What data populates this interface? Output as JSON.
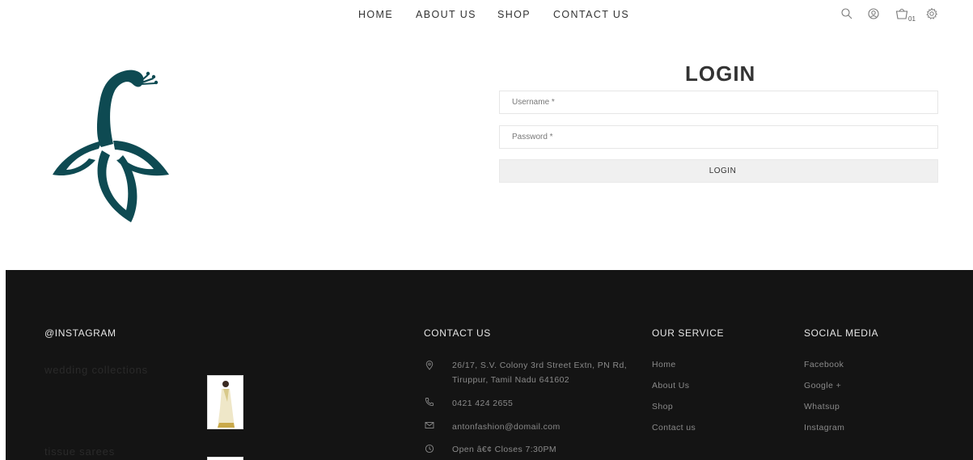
{
  "nav": {
    "items": [
      {
        "label": "HOME"
      },
      {
        "label": "ABOUT US"
      },
      {
        "label": "SHOP"
      },
      {
        "label": "CONTACT US"
      }
    ],
    "icons": [
      "search-icon",
      "user-icon",
      "cart-icon",
      "gear-icon"
    ],
    "cart_count": "01"
  },
  "login": {
    "title": "LOGIN",
    "username_placeholder": "Username *",
    "password_placeholder": "Password *",
    "button_label": "LOGIN"
  },
  "footer": {
    "instagram": {
      "heading": "@INSTAGRAM",
      "captions": [
        "wedding collections",
        "tissue sarees"
      ]
    },
    "contact": {
      "heading": "CONTACT US",
      "address_line1": "26/17, S.V. Colony 3rd Street Extn, PN Rd,",
      "address_line2": "Tiruppur, Tamil Nadu 641602",
      "phone": "0421 424 2655",
      "email": "antonfashion@domail.com",
      "hours": "Open â€¢ Closes 7:30PM"
    },
    "service": {
      "heading": "OUR SERVICE",
      "links": [
        "Home",
        "About Us",
        "Shop",
        "Contact us"
      ]
    },
    "social": {
      "heading": "SOCIAL MEDIA",
      "links": [
        "Facebook",
        "Google +",
        "Whatsup",
        "Instagram"
      ]
    }
  },
  "colors": {
    "brand_teal": "#0e4a52",
    "footer_bg": "#141414",
    "footer_text": "#8a8a8a",
    "footer_heading": "#e6e6e6"
  }
}
